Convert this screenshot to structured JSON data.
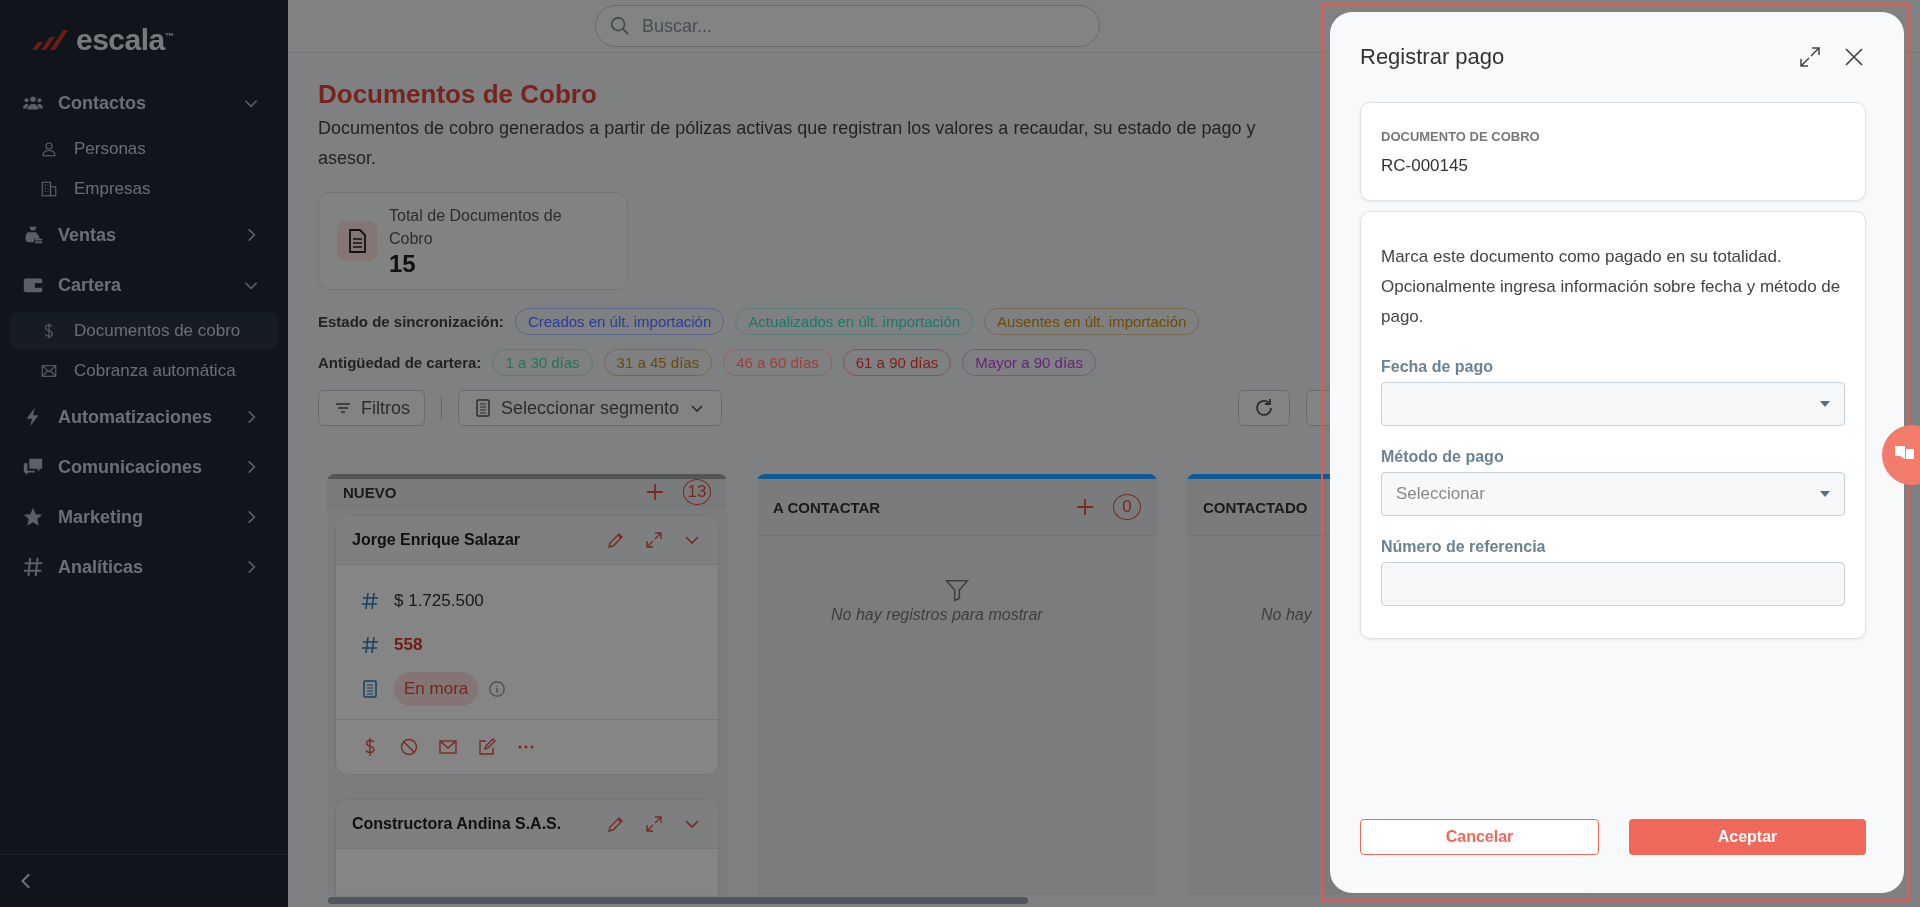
{
  "logo": {
    "text": "escala",
    "mark": "™"
  },
  "search": {
    "placeholder": "Buscar..."
  },
  "sidebar": {
    "items": [
      {
        "label": "Contactos",
        "expanded": true,
        "children": [
          {
            "label": "Personas",
            "selected": false
          },
          {
            "label": "Empresas",
            "selected": false
          }
        ]
      },
      {
        "label": "Ventas",
        "expanded": false
      },
      {
        "label": "Cartera",
        "expanded": true,
        "children": [
          {
            "label": "Documentos de cobro",
            "selected": true
          },
          {
            "label": "Cobranza automática",
            "selected": false
          }
        ]
      },
      {
        "label": "Automatizaciones",
        "expanded": false
      },
      {
        "label": "Comunicaciones",
        "expanded": false
      },
      {
        "label": "Marketing",
        "expanded": false
      },
      {
        "label": "Analíticas",
        "expanded": false
      }
    ]
  },
  "page": {
    "title": "Documentos de Cobro",
    "description": [
      "Documentos de cobro generados a partir de pólizas activas que registran los valores a recaudar, su estado de pago y",
      "asesor."
    ],
    "stat": {
      "label": "Total de Documentos de Cobro",
      "value": "15"
    },
    "filters": [
      {
        "label": "Estado de sincronización:",
        "chips": [
          {
            "label": "Creados en últ. importación",
            "color": "#2b3b9e"
          },
          {
            "label": "Actualizados en últ. importación",
            "color": "#1a7a68"
          },
          {
            "label": "Ausentes en últ. importación",
            "color": "#6e4c00"
          }
        ]
      },
      {
        "label": "Antigüedad de cartera:",
        "chips": [
          {
            "label": "1 a 30 días",
            "color": "#1a7a50"
          },
          {
            "label": "31 a 45 días",
            "color": "#6e4a00"
          },
          {
            "label": "46 a 60 días",
            "color": "#a83a36"
          },
          {
            "label": "61 a 90 días",
            "color": "#8a1a12"
          },
          {
            "label": "Mayor a 90 días",
            "color": "#6a2080"
          }
        ]
      }
    ],
    "toolbar": {
      "filter": "Filtros",
      "segment": "Seleccionar segmento"
    }
  },
  "columns": [
    {
      "title": "NUEVO",
      "count": "13",
      "color": "#555555",
      "cards": [
        {
          "name": "Jorge Enrique Salazar",
          "fields": [
            {
              "kind": "amount",
              "value": "$ 1.725.500"
            },
            {
              "kind": "days",
              "value": "558"
            },
            {
              "kind": "status",
              "value": "En mora"
            }
          ]
        },
        {
          "name": "Constructora Andina S.A.S."
        }
      ]
    },
    {
      "title": "A CONTACTAR",
      "count": "0",
      "color": "#0f5a96",
      "empty": "No hay registros para mostrar",
      "empty_icon": true
    },
    {
      "title": "CONTACTADO",
      "color": "#0f5a96",
      "empty": "No hay"
    }
  ],
  "modal": {
    "title": "Registrar pago",
    "doc_label": "DOCUMENTO DE COBRO",
    "doc_value": "RC-000145",
    "message": "Marca este documento como pagado en su totalidad. Opcionalmente ingresa información sobre fecha y método de pago.",
    "fields": [
      {
        "label": "Fecha de pago",
        "kind": "select"
      },
      {
        "label": "Método de pago",
        "kind": "select",
        "placeholder": "Seleccionar"
      },
      {
        "label": "Número de referencia",
        "kind": "text"
      }
    ],
    "cancel": "Cancelar",
    "accept": "Aceptar"
  }
}
